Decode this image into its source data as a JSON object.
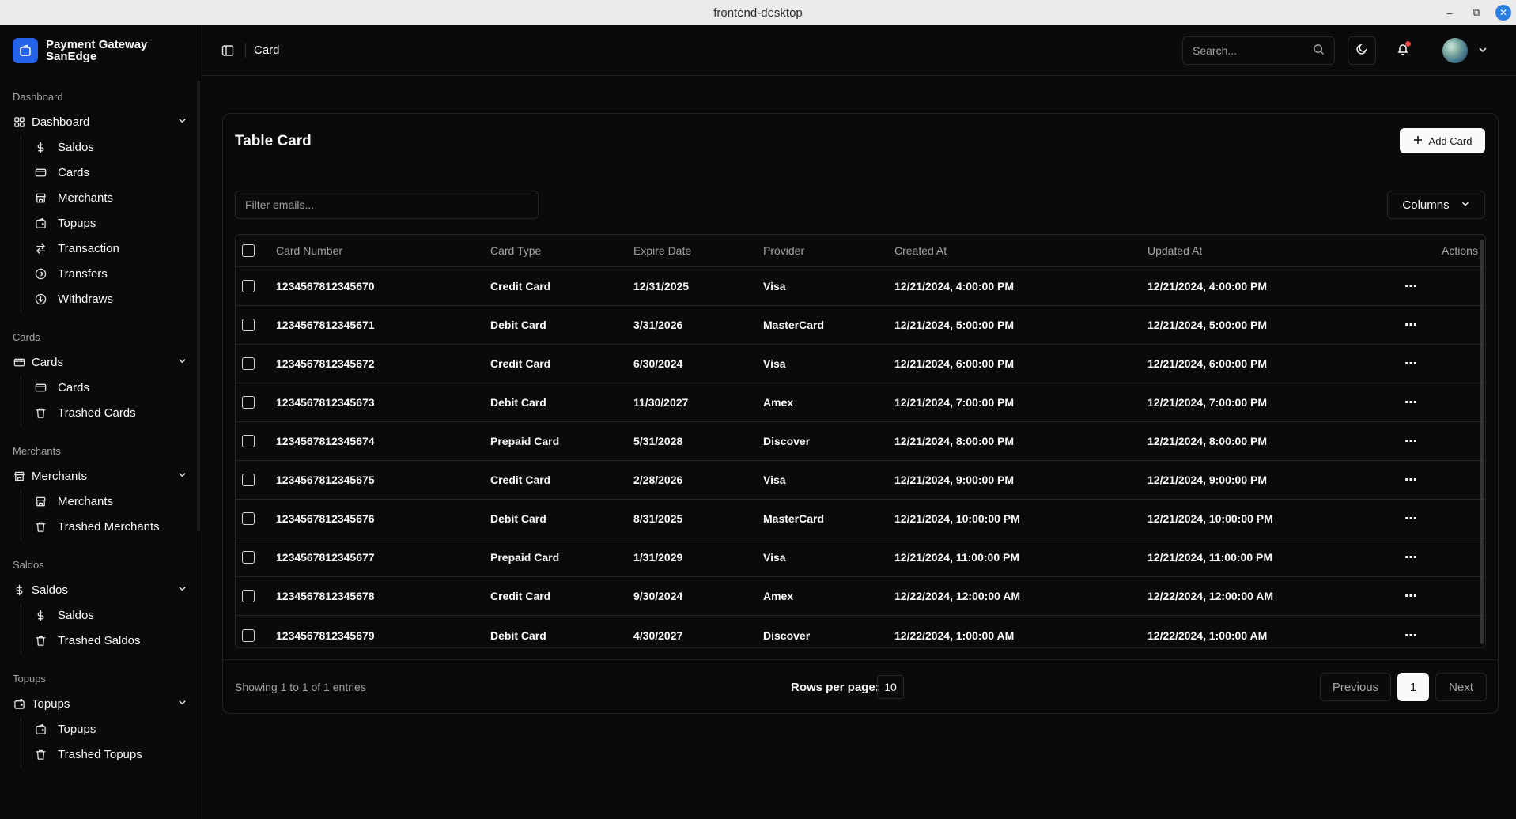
{
  "window": {
    "title": "frontend-desktop"
  },
  "brand": {
    "line1": "Payment Gateway",
    "line2": "SanEdge"
  },
  "sidebar": {
    "groups": [
      {
        "label": "Dashboard",
        "parent": "Dashboard",
        "parent_icon": "dashboard-grid-icon",
        "children": [
          {
            "label": "Saldos",
            "icon": "dollar-icon"
          },
          {
            "label": "Cards",
            "icon": "credit-card-icon"
          },
          {
            "label": "Merchants",
            "icon": "store-icon"
          },
          {
            "label": "Topups",
            "icon": "wallet-icon"
          },
          {
            "label": "Transaction",
            "icon": "arrows-left-right-icon"
          },
          {
            "label": "Transfers",
            "icon": "circle-arrow-right-icon"
          },
          {
            "label": "Withdraws",
            "icon": "circle-arrow-down-icon"
          }
        ]
      },
      {
        "label": "Cards",
        "parent": "Cards",
        "parent_icon": "credit-card-icon",
        "children": [
          {
            "label": "Cards",
            "icon": "credit-card-icon"
          },
          {
            "label": "Trashed Cards",
            "icon": "trash-icon"
          }
        ]
      },
      {
        "label": "Merchants",
        "parent": "Merchants",
        "parent_icon": "store-icon",
        "children": [
          {
            "label": "Merchants",
            "icon": "store-icon"
          },
          {
            "label": "Trashed Merchants",
            "icon": "trash-icon"
          }
        ]
      },
      {
        "label": "Saldos",
        "parent": "Saldos",
        "parent_icon": "dollar-icon",
        "children": [
          {
            "label": "Saldos",
            "icon": "dollar-icon"
          },
          {
            "label": "Trashed Saldos",
            "icon": "trash-icon"
          }
        ]
      },
      {
        "label": "Topups",
        "parent": "Topups",
        "parent_icon": "wallet-icon",
        "children": [
          {
            "label": "Topups",
            "icon": "wallet-icon"
          },
          {
            "label": "Trashed Topups",
            "icon": "trash-icon"
          }
        ]
      }
    ]
  },
  "header": {
    "breadcrumb": "Card",
    "search_placeholder": "Search..."
  },
  "main": {
    "title": "Table Card",
    "add_button": "Add Card",
    "filter_placeholder": "Filter emails...",
    "columns_button": "Columns",
    "table": {
      "headers": [
        "Card Number",
        "Card Type",
        "Expire Date",
        "Provider",
        "Created At",
        "Updated At",
        "Actions"
      ],
      "rows": [
        [
          "1234567812345670",
          "Credit Card",
          "12/31/2025",
          "Visa",
          "12/21/2024, 4:00:00 PM",
          "12/21/2024, 4:00:00 PM"
        ],
        [
          "1234567812345671",
          "Debit Card",
          "3/31/2026",
          "MasterCard",
          "12/21/2024, 5:00:00 PM",
          "12/21/2024, 5:00:00 PM"
        ],
        [
          "1234567812345672",
          "Credit Card",
          "6/30/2024",
          "Visa",
          "12/21/2024, 6:00:00 PM",
          "12/21/2024, 6:00:00 PM"
        ],
        [
          "1234567812345673",
          "Debit Card",
          "11/30/2027",
          "Amex",
          "12/21/2024, 7:00:00 PM",
          "12/21/2024, 7:00:00 PM"
        ],
        [
          "1234567812345674",
          "Prepaid Card",
          "5/31/2028",
          "Discover",
          "12/21/2024, 8:00:00 PM",
          "12/21/2024, 8:00:00 PM"
        ],
        [
          "1234567812345675",
          "Credit Card",
          "2/28/2026",
          "Visa",
          "12/21/2024, 9:00:00 PM",
          "12/21/2024, 9:00:00 PM"
        ],
        [
          "1234567812345676",
          "Debit Card",
          "8/31/2025",
          "MasterCard",
          "12/21/2024, 10:00:00 PM",
          "12/21/2024, 10:00:00 PM"
        ],
        [
          "1234567812345677",
          "Prepaid Card",
          "1/31/2029",
          "Visa",
          "12/21/2024, 11:00:00 PM",
          "12/21/2024, 11:00:00 PM"
        ],
        [
          "1234567812345678",
          "Credit Card",
          "9/30/2024",
          "Amex",
          "12/22/2024, 12:00:00 AM",
          "12/22/2024, 12:00:00 AM"
        ],
        [
          "1234567812345679",
          "Debit Card",
          "4/30/2027",
          "Discover",
          "12/22/2024, 1:00:00 AM",
          "12/22/2024, 1:00:00 AM"
        ]
      ]
    },
    "footer": {
      "showing": "Showing 1 to 1 of 1 entries",
      "rows_per_page_label": "Rows per page:",
      "rows_per_page_value": "10",
      "previous": "Previous",
      "current_page": "1",
      "next": "Next"
    }
  },
  "colors": {
    "accent": "#2563eb",
    "notification": "#ef4444",
    "background": "#0a0a0a"
  }
}
